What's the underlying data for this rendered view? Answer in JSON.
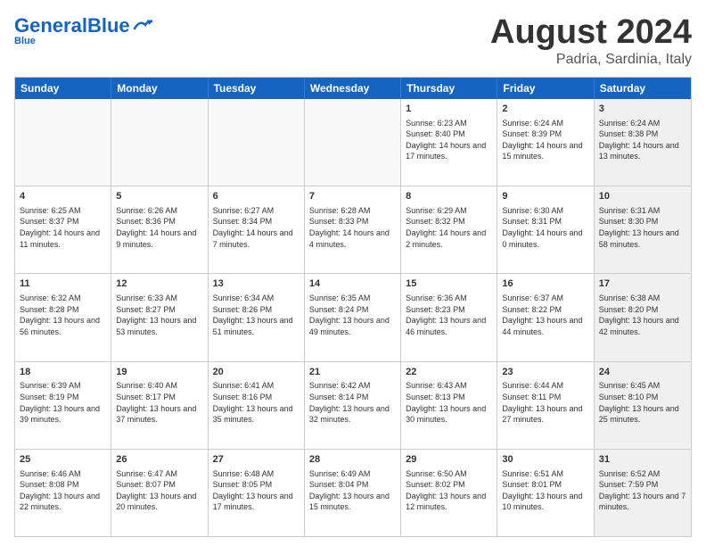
{
  "header": {
    "logo": {
      "part1": "General",
      "part2": "Blue"
    },
    "title": "August 2024",
    "location": "Padria, Sardinia, Italy"
  },
  "calendar": {
    "days": [
      "Sunday",
      "Monday",
      "Tuesday",
      "Wednesday",
      "Thursday",
      "Friday",
      "Saturday"
    ],
    "rows": [
      [
        {
          "day": "",
          "info": "",
          "empty": true
        },
        {
          "day": "",
          "info": "",
          "empty": true
        },
        {
          "day": "",
          "info": "",
          "empty": true
        },
        {
          "day": "",
          "info": "",
          "empty": true
        },
        {
          "day": "1",
          "info": "Sunrise: 6:23 AM\nSunset: 8:40 PM\nDaylight: 14 hours\nand 17 minutes.",
          "empty": false
        },
        {
          "day": "2",
          "info": "Sunrise: 6:24 AM\nSunset: 8:39 PM\nDaylight: 14 hours\nand 15 minutes.",
          "empty": false
        },
        {
          "day": "3",
          "info": "Sunrise: 6:24 AM\nSunset: 8:38 PM\nDaylight: 14 hours\nand 13 minutes.",
          "empty": false,
          "shaded": true
        }
      ],
      [
        {
          "day": "4",
          "info": "Sunrise: 6:25 AM\nSunset: 8:37 PM\nDaylight: 14 hours\nand 11 minutes.",
          "empty": false
        },
        {
          "day": "5",
          "info": "Sunrise: 6:26 AM\nSunset: 8:36 PM\nDaylight: 14 hours\nand 9 minutes.",
          "empty": false
        },
        {
          "day": "6",
          "info": "Sunrise: 6:27 AM\nSunset: 8:34 PM\nDaylight: 14 hours\nand 7 minutes.",
          "empty": false
        },
        {
          "day": "7",
          "info": "Sunrise: 6:28 AM\nSunset: 8:33 PM\nDaylight: 14 hours\nand 4 minutes.",
          "empty": false
        },
        {
          "day": "8",
          "info": "Sunrise: 6:29 AM\nSunset: 8:32 PM\nDaylight: 14 hours\nand 2 minutes.",
          "empty": false
        },
        {
          "day": "9",
          "info": "Sunrise: 6:30 AM\nSunset: 8:31 PM\nDaylight: 14 hours\nand 0 minutes.",
          "empty": false
        },
        {
          "day": "10",
          "info": "Sunrise: 6:31 AM\nSunset: 8:30 PM\nDaylight: 13 hours\nand 58 minutes.",
          "empty": false,
          "shaded": true
        }
      ],
      [
        {
          "day": "11",
          "info": "Sunrise: 6:32 AM\nSunset: 8:28 PM\nDaylight: 13 hours\nand 56 minutes.",
          "empty": false
        },
        {
          "day": "12",
          "info": "Sunrise: 6:33 AM\nSunset: 8:27 PM\nDaylight: 13 hours\nand 53 minutes.",
          "empty": false
        },
        {
          "day": "13",
          "info": "Sunrise: 6:34 AM\nSunset: 8:26 PM\nDaylight: 13 hours\nand 51 minutes.",
          "empty": false
        },
        {
          "day": "14",
          "info": "Sunrise: 6:35 AM\nSunset: 8:24 PM\nDaylight: 13 hours\nand 49 minutes.",
          "empty": false
        },
        {
          "day": "15",
          "info": "Sunrise: 6:36 AM\nSunset: 8:23 PM\nDaylight: 13 hours\nand 46 minutes.",
          "empty": false
        },
        {
          "day": "16",
          "info": "Sunrise: 6:37 AM\nSunset: 8:22 PM\nDaylight: 13 hours\nand 44 minutes.",
          "empty": false
        },
        {
          "day": "17",
          "info": "Sunrise: 6:38 AM\nSunset: 8:20 PM\nDaylight: 13 hours\nand 42 minutes.",
          "empty": false,
          "shaded": true
        }
      ],
      [
        {
          "day": "18",
          "info": "Sunrise: 6:39 AM\nSunset: 8:19 PM\nDaylight: 13 hours\nand 39 minutes.",
          "empty": false
        },
        {
          "day": "19",
          "info": "Sunrise: 6:40 AM\nSunset: 8:17 PM\nDaylight: 13 hours\nand 37 minutes.",
          "empty": false
        },
        {
          "day": "20",
          "info": "Sunrise: 6:41 AM\nSunset: 8:16 PM\nDaylight: 13 hours\nand 35 minutes.",
          "empty": false
        },
        {
          "day": "21",
          "info": "Sunrise: 6:42 AM\nSunset: 8:14 PM\nDaylight: 13 hours\nand 32 minutes.",
          "empty": false
        },
        {
          "day": "22",
          "info": "Sunrise: 6:43 AM\nSunset: 8:13 PM\nDaylight: 13 hours\nand 30 minutes.",
          "empty": false
        },
        {
          "day": "23",
          "info": "Sunrise: 6:44 AM\nSunset: 8:11 PM\nDaylight: 13 hours\nand 27 minutes.",
          "empty": false
        },
        {
          "day": "24",
          "info": "Sunrise: 6:45 AM\nSunset: 8:10 PM\nDaylight: 13 hours\nand 25 minutes.",
          "empty": false,
          "shaded": true
        }
      ],
      [
        {
          "day": "25",
          "info": "Sunrise: 6:46 AM\nSunset: 8:08 PM\nDaylight: 13 hours\nand 22 minutes.",
          "empty": false
        },
        {
          "day": "26",
          "info": "Sunrise: 6:47 AM\nSunset: 8:07 PM\nDaylight: 13 hours\nand 20 minutes.",
          "empty": false
        },
        {
          "day": "27",
          "info": "Sunrise: 6:48 AM\nSunset: 8:05 PM\nDaylight: 13 hours\nand 17 minutes.",
          "empty": false
        },
        {
          "day": "28",
          "info": "Sunrise: 6:49 AM\nSunset: 8:04 PM\nDaylight: 13 hours\nand 15 minutes.",
          "empty": false
        },
        {
          "day": "29",
          "info": "Sunrise: 6:50 AM\nSunset: 8:02 PM\nDaylight: 13 hours\nand 12 minutes.",
          "empty": false
        },
        {
          "day": "30",
          "info": "Sunrise: 6:51 AM\nSunset: 8:01 PM\nDaylight: 13 hours\nand 10 minutes.",
          "empty": false
        },
        {
          "day": "31",
          "info": "Sunrise: 6:52 AM\nSunset: 7:59 PM\nDaylight: 13 hours\nand 7 minutes.",
          "empty": false,
          "shaded": true
        }
      ]
    ]
  }
}
